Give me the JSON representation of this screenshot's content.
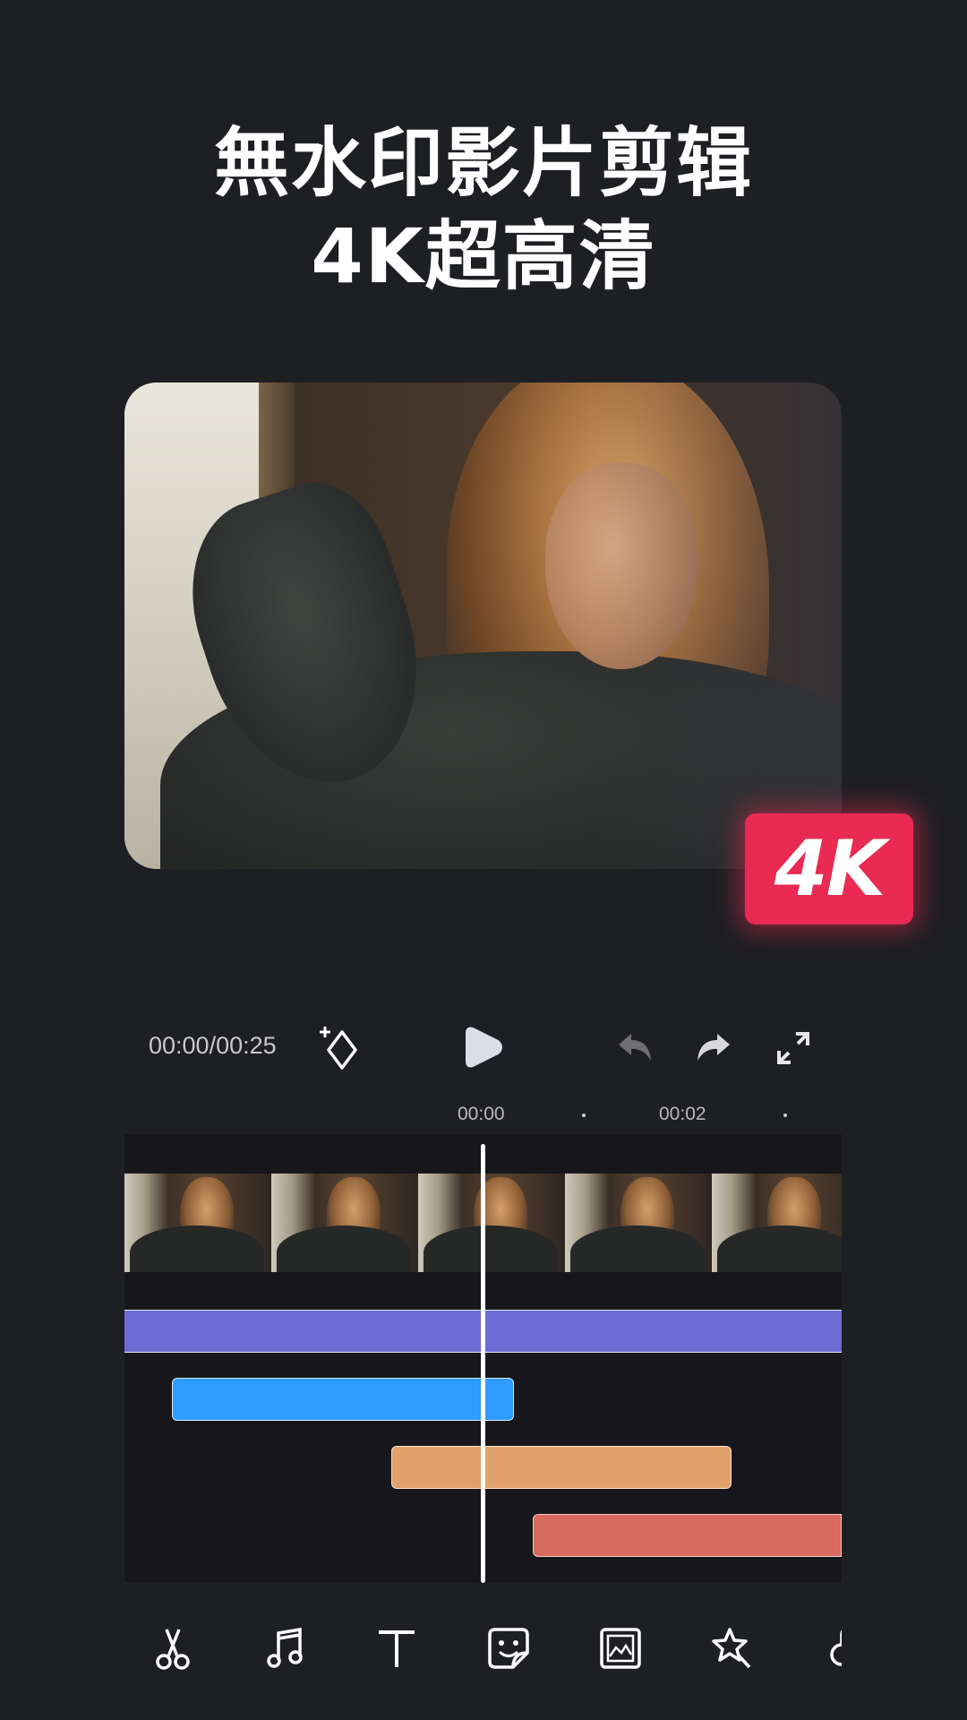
{
  "header": {
    "line1": "無水印影片剪辑",
    "line2": "4K超高清"
  },
  "badge": {
    "label": "4K",
    "color": "#e92a52"
  },
  "player": {
    "time_readout": "00:00/00:25",
    "icons": {
      "keyframe": "add-keyframe-icon",
      "play": "play-icon",
      "undo": "undo-icon",
      "redo": "redo-icon",
      "fullscreen": "fullscreen-icon"
    }
  },
  "timeline": {
    "ruler_labels": [
      "00:00",
      "00:02"
    ],
    "tracks": [
      {
        "name": "video-track",
        "color": "#6f6bd4"
      },
      {
        "name": "music-track",
        "color": "#2e9bff"
      },
      {
        "name": "text-track",
        "color": "#e0a26a"
      },
      {
        "name": "effect-track",
        "color": "#d86a5e"
      }
    ]
  },
  "toolbar": {
    "tools": [
      "cut-icon",
      "music-icon",
      "text-icon",
      "sticker-icon",
      "image-icon",
      "effects-icon",
      "more-icon"
    ]
  }
}
